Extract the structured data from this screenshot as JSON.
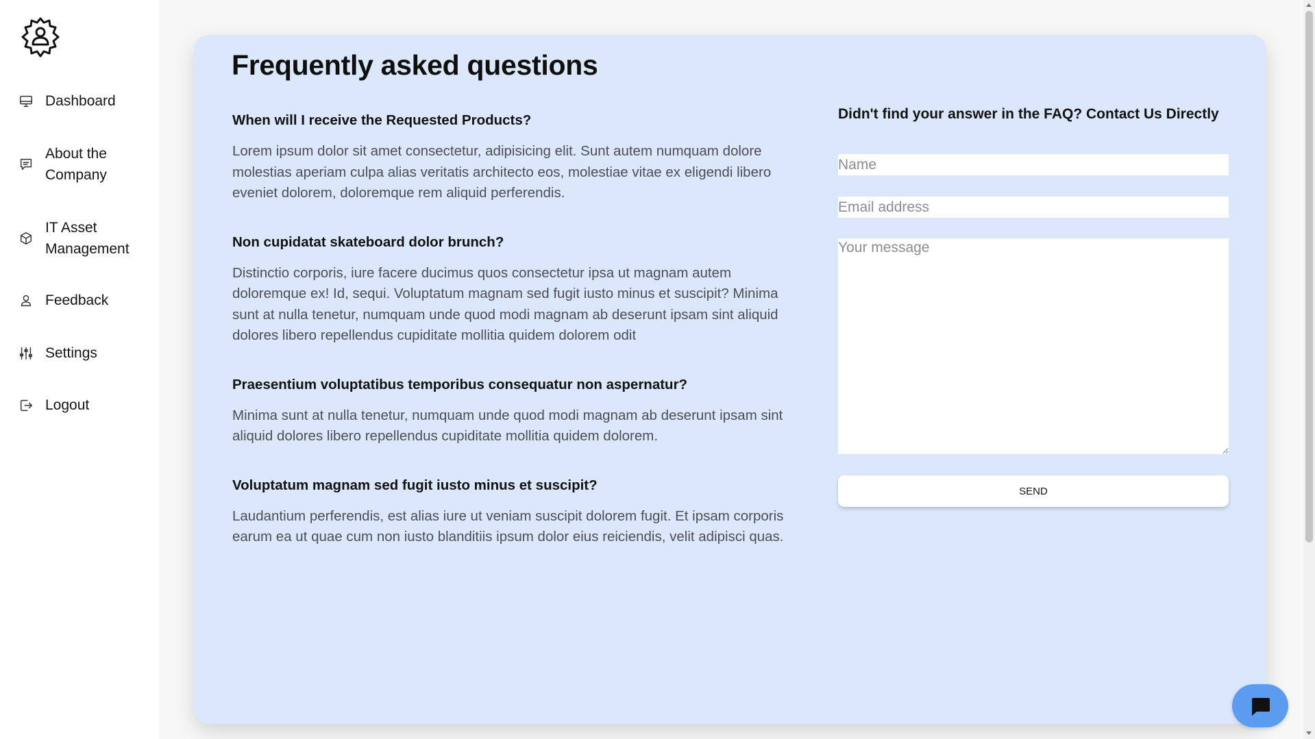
{
  "sidebar": {
    "logo_icon": "gear-person-icon",
    "items": [
      {
        "label": "Dashboard",
        "icon": "monitor-icon"
      },
      {
        "label": "About the Company",
        "icon": "message-icon"
      },
      {
        "label": "IT Asset Management",
        "icon": "box-icon"
      },
      {
        "label": "Feedback",
        "icon": "user-icon"
      },
      {
        "label": "Settings",
        "icon": "sliders-icon"
      },
      {
        "label": "Logout",
        "icon": "logout-icon"
      }
    ]
  },
  "faq": {
    "title": "Frequently asked questions",
    "items": [
      {
        "question": "When will I receive the Requested Products?",
        "answer": "Lorem ipsum dolor sit amet consectetur, adipisicing elit. Sunt autem numquam dolore molestias aperiam culpa alias veritatis architecto eos, molestiae vitae ex eligendi libero eveniet dolorem, doloremque rem aliquid perferendis."
      },
      {
        "question": "Non cupidatat skateboard dolor brunch?",
        "answer": "Distinctio corporis, iure facere ducimus quos consectetur ipsa ut magnam autem doloremque ex! Id, sequi. Voluptatum magnam sed fugit iusto minus et suscipit? Minima sunt at nulla tenetur, numquam unde quod modi magnam ab deserunt ipsam sint aliquid dolores libero repellendus cupiditate mollitia quidem dolorem odit"
      },
      {
        "question": "Praesentium voluptatibus temporibus consequatur non aspernatur?",
        "answer": "Minima sunt at nulla tenetur, numquam unde quod modi magnam ab deserunt ipsam sint aliquid dolores libero repellendus cupiditate mollitia quidem dolorem."
      },
      {
        "question": "Voluptatum magnam sed fugit iusto minus et suscipit?",
        "answer": "Laudantium perferendis, est alias iure ut veniam suscipit dolorem fugit. Et ipsam corporis earum ea ut quae cum non iusto blanditiis ipsum dolor eius reiciendis, velit adipisci quas."
      }
    ]
  },
  "contact": {
    "title": "Didn't find your answer in the FAQ? Contact Us Directly",
    "name_placeholder": "Name",
    "email_placeholder": "Email address",
    "message_placeholder": "Your message",
    "send_label": "SEND"
  },
  "chat": {
    "icon": "chat-bubble-icon"
  },
  "colors": {
    "card_background": "#dbe8fc",
    "chat_button": "#5b9cf0",
    "sidebar_background": "#ffffff"
  }
}
